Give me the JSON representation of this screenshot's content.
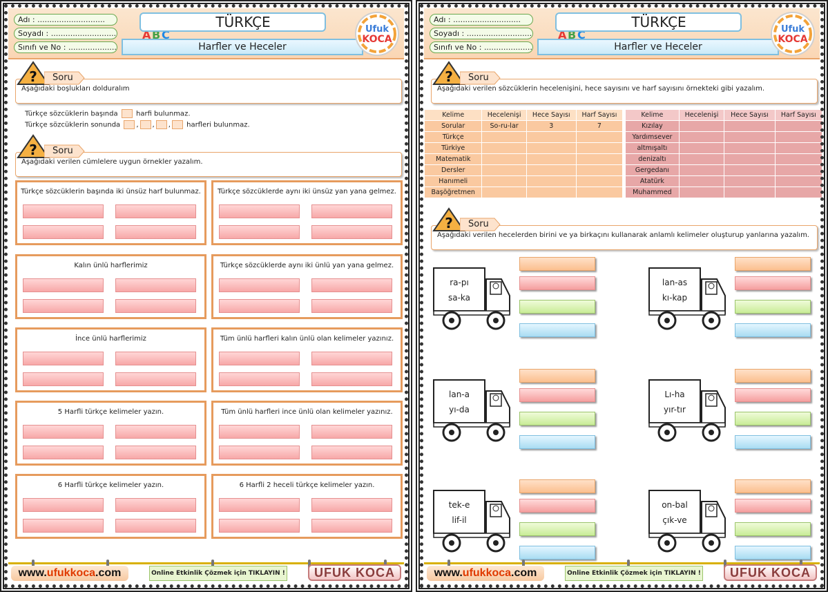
{
  "header": {
    "name_label": "Adı :",
    "surname_label": "Soyadı :",
    "class_label": "Sınıfı ve No :",
    "dots": "............................",
    "subject": "TÜRKÇE",
    "topic": "Harfler ve Heceler",
    "abc": "ABC",
    "logo_top": "Ufuk",
    "logo_bottom": "KOCA"
  },
  "soru_label": "Soru",
  "left": {
    "q1": "Aşağıdaki boşlukları dolduralım",
    "fill1_a": "Türkçe sözcüklerin başında",
    "fill1_b": "harfi bulunmaz.",
    "fill2_a": "Türkçe sözcüklerin sonunda",
    "fill2_b": "harfleri bulunmaz.",
    "q2": "Aşağıdaki verilen cümlelere uygun örnekler yazalım.",
    "boxes": [
      "Türkçe sözcüklerin başında iki ünsüz harf bulunmaz.",
      "Türkçe sözcüklerde aynı iki ünsüz yan yana gelmez.",
      "Kalın ünlü harflerimiz",
      "Türkçe sözcüklerde aynı iki ünlü yan yana gelmez.",
      "İnce ünlü harflerimiz",
      "Tüm ünlü harfleri kalın ünlü olan kelimeler yazınız.",
      "5 Harfli türkçe kelimeler yazın.",
      "Tüm ünlü harfleri ince ünlü olan kelimeler yazınız.",
      "6 Harfli türkçe kelimeler yazın.",
      "6 Harfli 2 heceli türkçe kelimeler yazın."
    ]
  },
  "right": {
    "q1": "Aşağıdaki verilen sözcüklerin hecelenişini, hece sayısını ve harf sayısını örnekteki gibi yazalım.",
    "table_headers": [
      "Kelime",
      "Hecelenişi",
      "Hece Sayısı",
      "Harf Sayısı"
    ],
    "table_left_rows": [
      [
        "Sorular",
        "So-ru-lar",
        "3",
        "7"
      ],
      [
        "Türkçe",
        "",
        "",
        ""
      ],
      [
        "Türkiye",
        "",
        "",
        ""
      ],
      [
        "Matematik",
        "",
        "",
        ""
      ],
      [
        "Dersler",
        "",
        "",
        ""
      ],
      [
        "Hanımeli",
        "",
        "",
        ""
      ],
      [
        "Başöğretmen",
        "",
        "",
        ""
      ]
    ],
    "table_right_rows": [
      [
        "Kızılay",
        "",
        "",
        ""
      ],
      [
        "Yardımsever",
        "",
        "",
        ""
      ],
      [
        "altmışaltı",
        "",
        "",
        ""
      ],
      [
        "denizaltı",
        "",
        "",
        ""
      ],
      [
        "Gergedanı",
        "",
        "",
        ""
      ],
      [
        "Atatürk",
        "",
        "",
        ""
      ],
      [
        "Muhammed",
        "",
        "",
        ""
      ]
    ],
    "q2": "Aşağıdaki verilen hecelerden birini ve ya birkaçını kullanarak anlamlı kelimeler oluşturup yanlarına yazalım.",
    "trucks": [
      [
        "ra-pı",
        "sa-ka"
      ],
      [
        "lan-as",
        "kı-kap"
      ],
      [
        "lan-a",
        "yı-da"
      ],
      [
        "Lı-ha",
        "yır-tır"
      ],
      [
        "tek-e",
        "lif-il"
      ],
      [
        "on-bal",
        "çık-ve"
      ]
    ]
  },
  "footer": {
    "www_pre": "www.",
    "www_mid": "ufukkoca",
    "www_post": ".com",
    "online": "Online Etkinlik Çözmek için TIKLAYIN !",
    "brand": "UFUK KOCA"
  }
}
